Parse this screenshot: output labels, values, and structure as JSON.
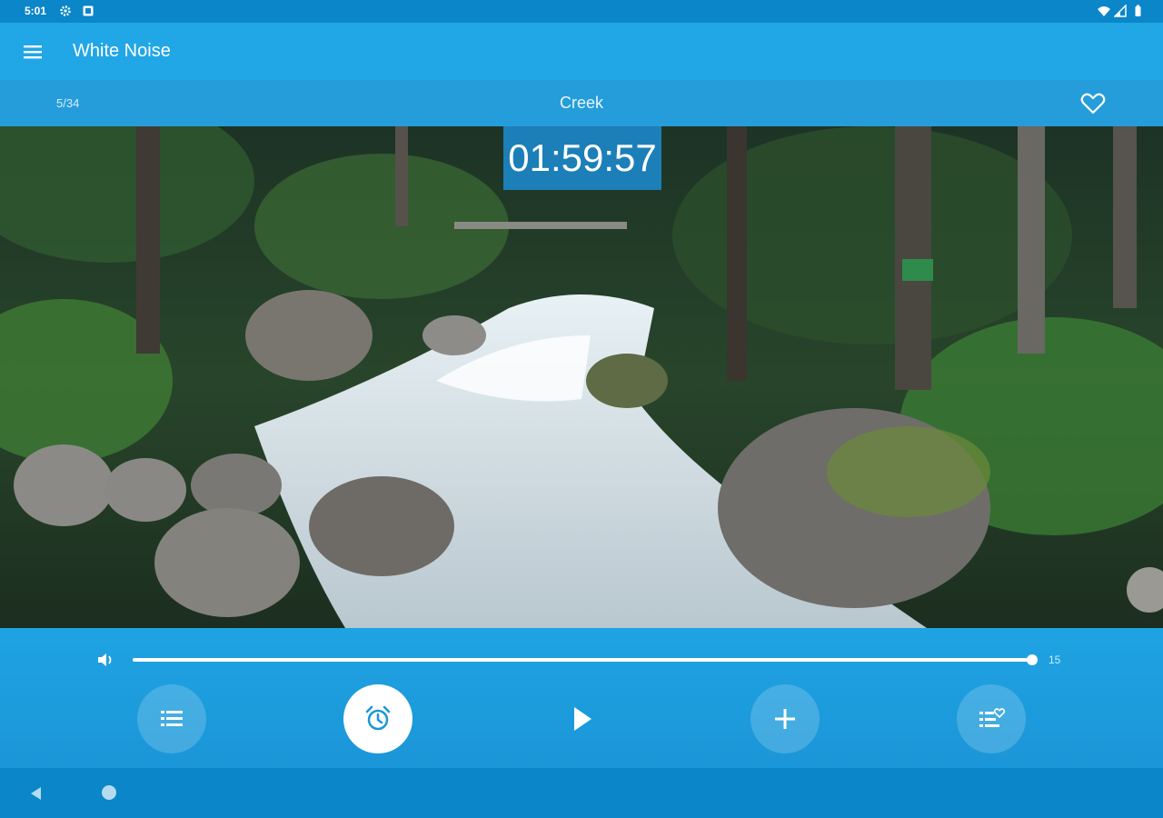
{
  "status_bar": {
    "time": "5:01",
    "icons": [
      "settings-icon",
      "notification-icon",
      "wifi-icon",
      "signal-icon",
      "battery-icon"
    ]
  },
  "app_bar": {
    "title": "White Noise",
    "menu_icon": "hamburger-menu-icon"
  },
  "player": {
    "track_position": "5/34",
    "sound_name": "Creek",
    "favorite_icon": "heart-outline-icon",
    "timer": "01:59:57",
    "scene": "forest creek with rocks and rapids"
  },
  "volume": {
    "icon": "speaker-icon",
    "value": "15",
    "level_fraction": 1.0
  },
  "controls": [
    {
      "name": "sound-list-button",
      "icon": "list-icon"
    },
    {
      "name": "alarm-timer-button",
      "icon": "alarm-clock-icon"
    },
    {
      "name": "play-button",
      "icon": "play-icon"
    },
    {
      "name": "add-button",
      "icon": "plus-icon"
    },
    {
      "name": "favorites-list-button",
      "icon": "list-heart-icon"
    }
  ],
  "colors": {
    "primary": "#21a6e6",
    "status_bar": "#0a86c9",
    "timer_background": "#1c7fb8",
    "controls_background": "#1fa3e2"
  }
}
